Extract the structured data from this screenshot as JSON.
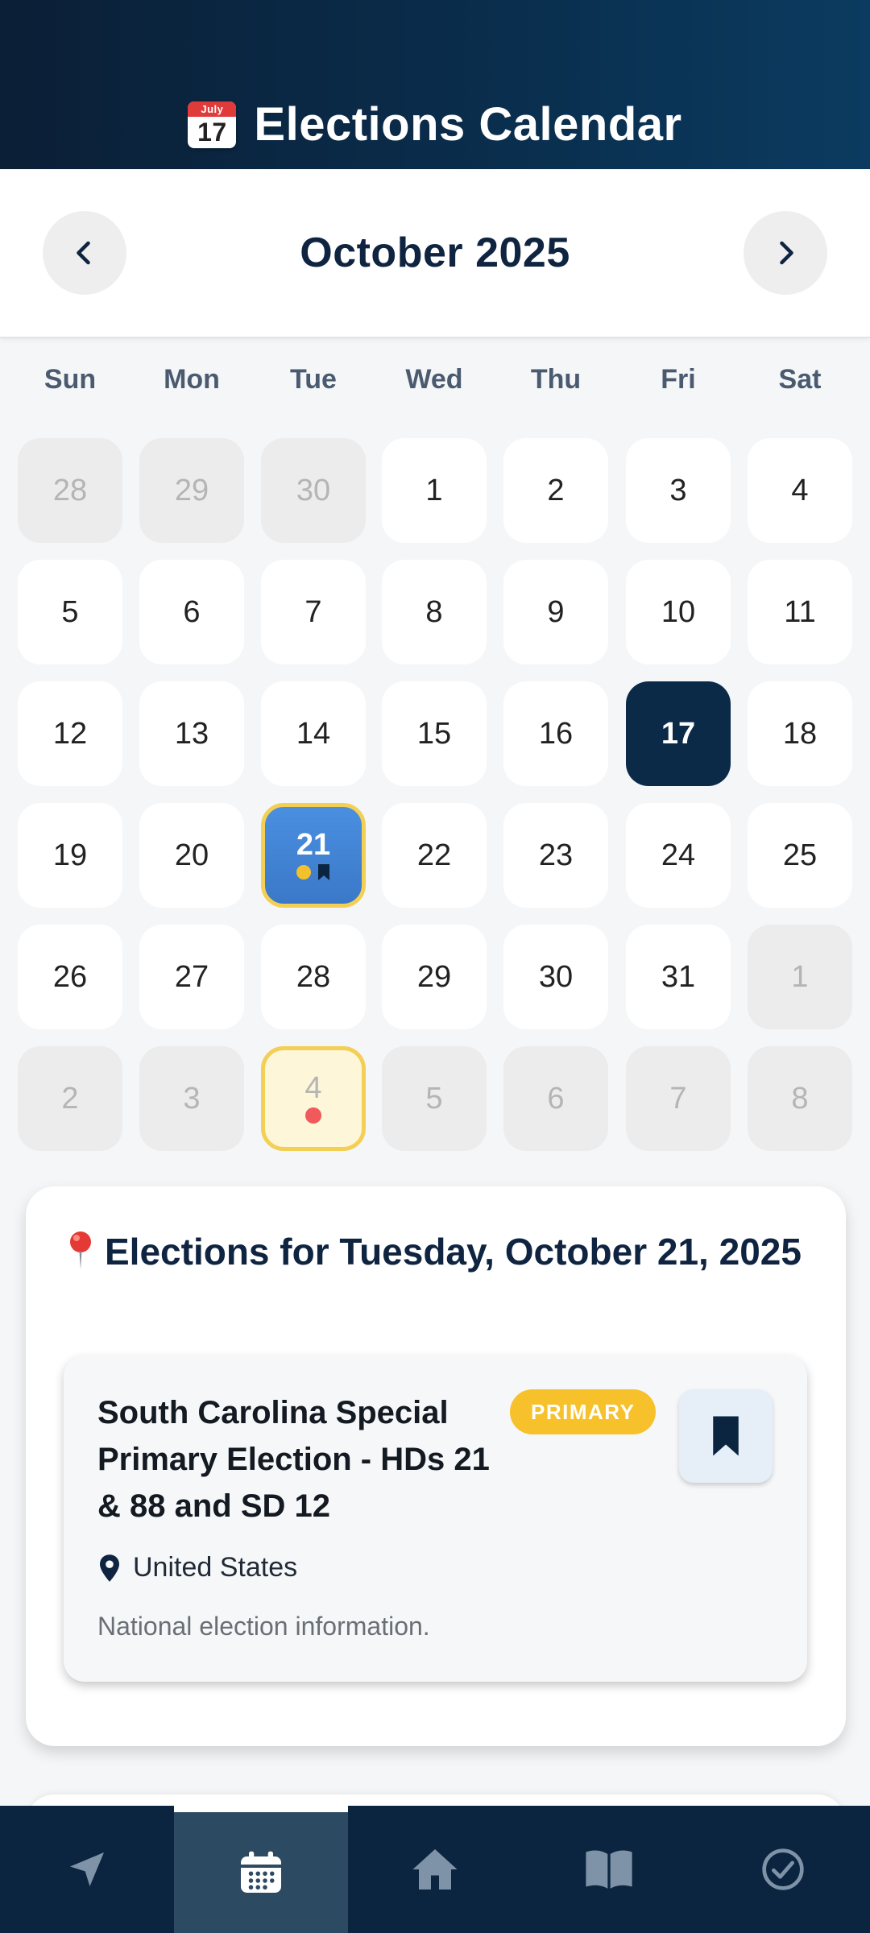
{
  "header": {
    "title": "Elections Calendar",
    "emoji_month": "July",
    "emoji_day": "17"
  },
  "month_nav": {
    "label": "October 2025",
    "prev_icon": "chevron-left-icon",
    "next_icon": "chevron-right-icon"
  },
  "weekdays": [
    "Sun",
    "Mon",
    "Tue",
    "Wed",
    "Thu",
    "Fri",
    "Sat"
  ],
  "days": [
    {
      "label": "28",
      "state": "out"
    },
    {
      "label": "29",
      "state": "out"
    },
    {
      "label": "30",
      "state": "out"
    },
    {
      "label": "1",
      "state": "normal"
    },
    {
      "label": "2",
      "state": "normal"
    },
    {
      "label": "3",
      "state": "normal"
    },
    {
      "label": "4",
      "state": "normal"
    },
    {
      "label": "5",
      "state": "normal"
    },
    {
      "label": "6",
      "state": "normal"
    },
    {
      "label": "7",
      "state": "normal"
    },
    {
      "label": "8",
      "state": "normal"
    },
    {
      "label": "9",
      "state": "normal"
    },
    {
      "label": "10",
      "state": "normal"
    },
    {
      "label": "11",
      "state": "normal"
    },
    {
      "label": "12",
      "state": "normal"
    },
    {
      "label": "13",
      "state": "normal"
    },
    {
      "label": "14",
      "state": "normal"
    },
    {
      "label": "15",
      "state": "normal"
    },
    {
      "label": "16",
      "state": "normal"
    },
    {
      "label": "17",
      "state": "today"
    },
    {
      "label": "18",
      "state": "normal"
    },
    {
      "label": "19",
      "state": "normal"
    },
    {
      "label": "20",
      "state": "normal"
    },
    {
      "label": "21",
      "state": "selected",
      "markers": [
        "yellow-dot",
        "bookmark"
      ]
    },
    {
      "label": "22",
      "state": "normal"
    },
    {
      "label": "23",
      "state": "normal"
    },
    {
      "label": "24",
      "state": "normal"
    },
    {
      "label": "25",
      "state": "normal"
    },
    {
      "label": "26",
      "state": "normal"
    },
    {
      "label": "27",
      "state": "normal"
    },
    {
      "label": "28",
      "state": "normal"
    },
    {
      "label": "29",
      "state": "normal"
    },
    {
      "label": "30",
      "state": "normal"
    },
    {
      "label": "31",
      "state": "normal"
    },
    {
      "label": "1",
      "state": "out"
    },
    {
      "label": "2",
      "state": "out"
    },
    {
      "label": "3",
      "state": "out"
    },
    {
      "label": "4",
      "state": "event-out",
      "markers": [
        "red-dot"
      ]
    },
    {
      "label": "5",
      "state": "out"
    },
    {
      "label": "6",
      "state": "out"
    },
    {
      "label": "7",
      "state": "out"
    },
    {
      "label": "8",
      "state": "out"
    }
  ],
  "elections_panel": {
    "title": "Elections for Tuesday, October 21, 2025",
    "title_icon": "pin-icon",
    "items": [
      {
        "title": "South Carolina Special Primary Election - HDs 21 & 88 and SD 12",
        "badge": "PRIMARY",
        "location": "United States",
        "description": "National election information.",
        "bookmark_icon": "bookmark-icon"
      }
    ]
  },
  "bottom_nav": [
    {
      "icon": "navigation-arrow-icon",
      "active": false
    },
    {
      "icon": "calendar-icon",
      "active": true
    },
    {
      "icon": "home-icon",
      "active": false
    },
    {
      "icon": "book-icon",
      "active": false
    },
    {
      "icon": "check-circle-icon",
      "active": false
    }
  ],
  "colors": {
    "header_dark": "#0b1f36",
    "today": "#0b2a48",
    "selected": "#3b78c8",
    "highlight_border": "#f3cf55",
    "badge": "#f7c12c",
    "nav_bg": "#0b2540"
  }
}
